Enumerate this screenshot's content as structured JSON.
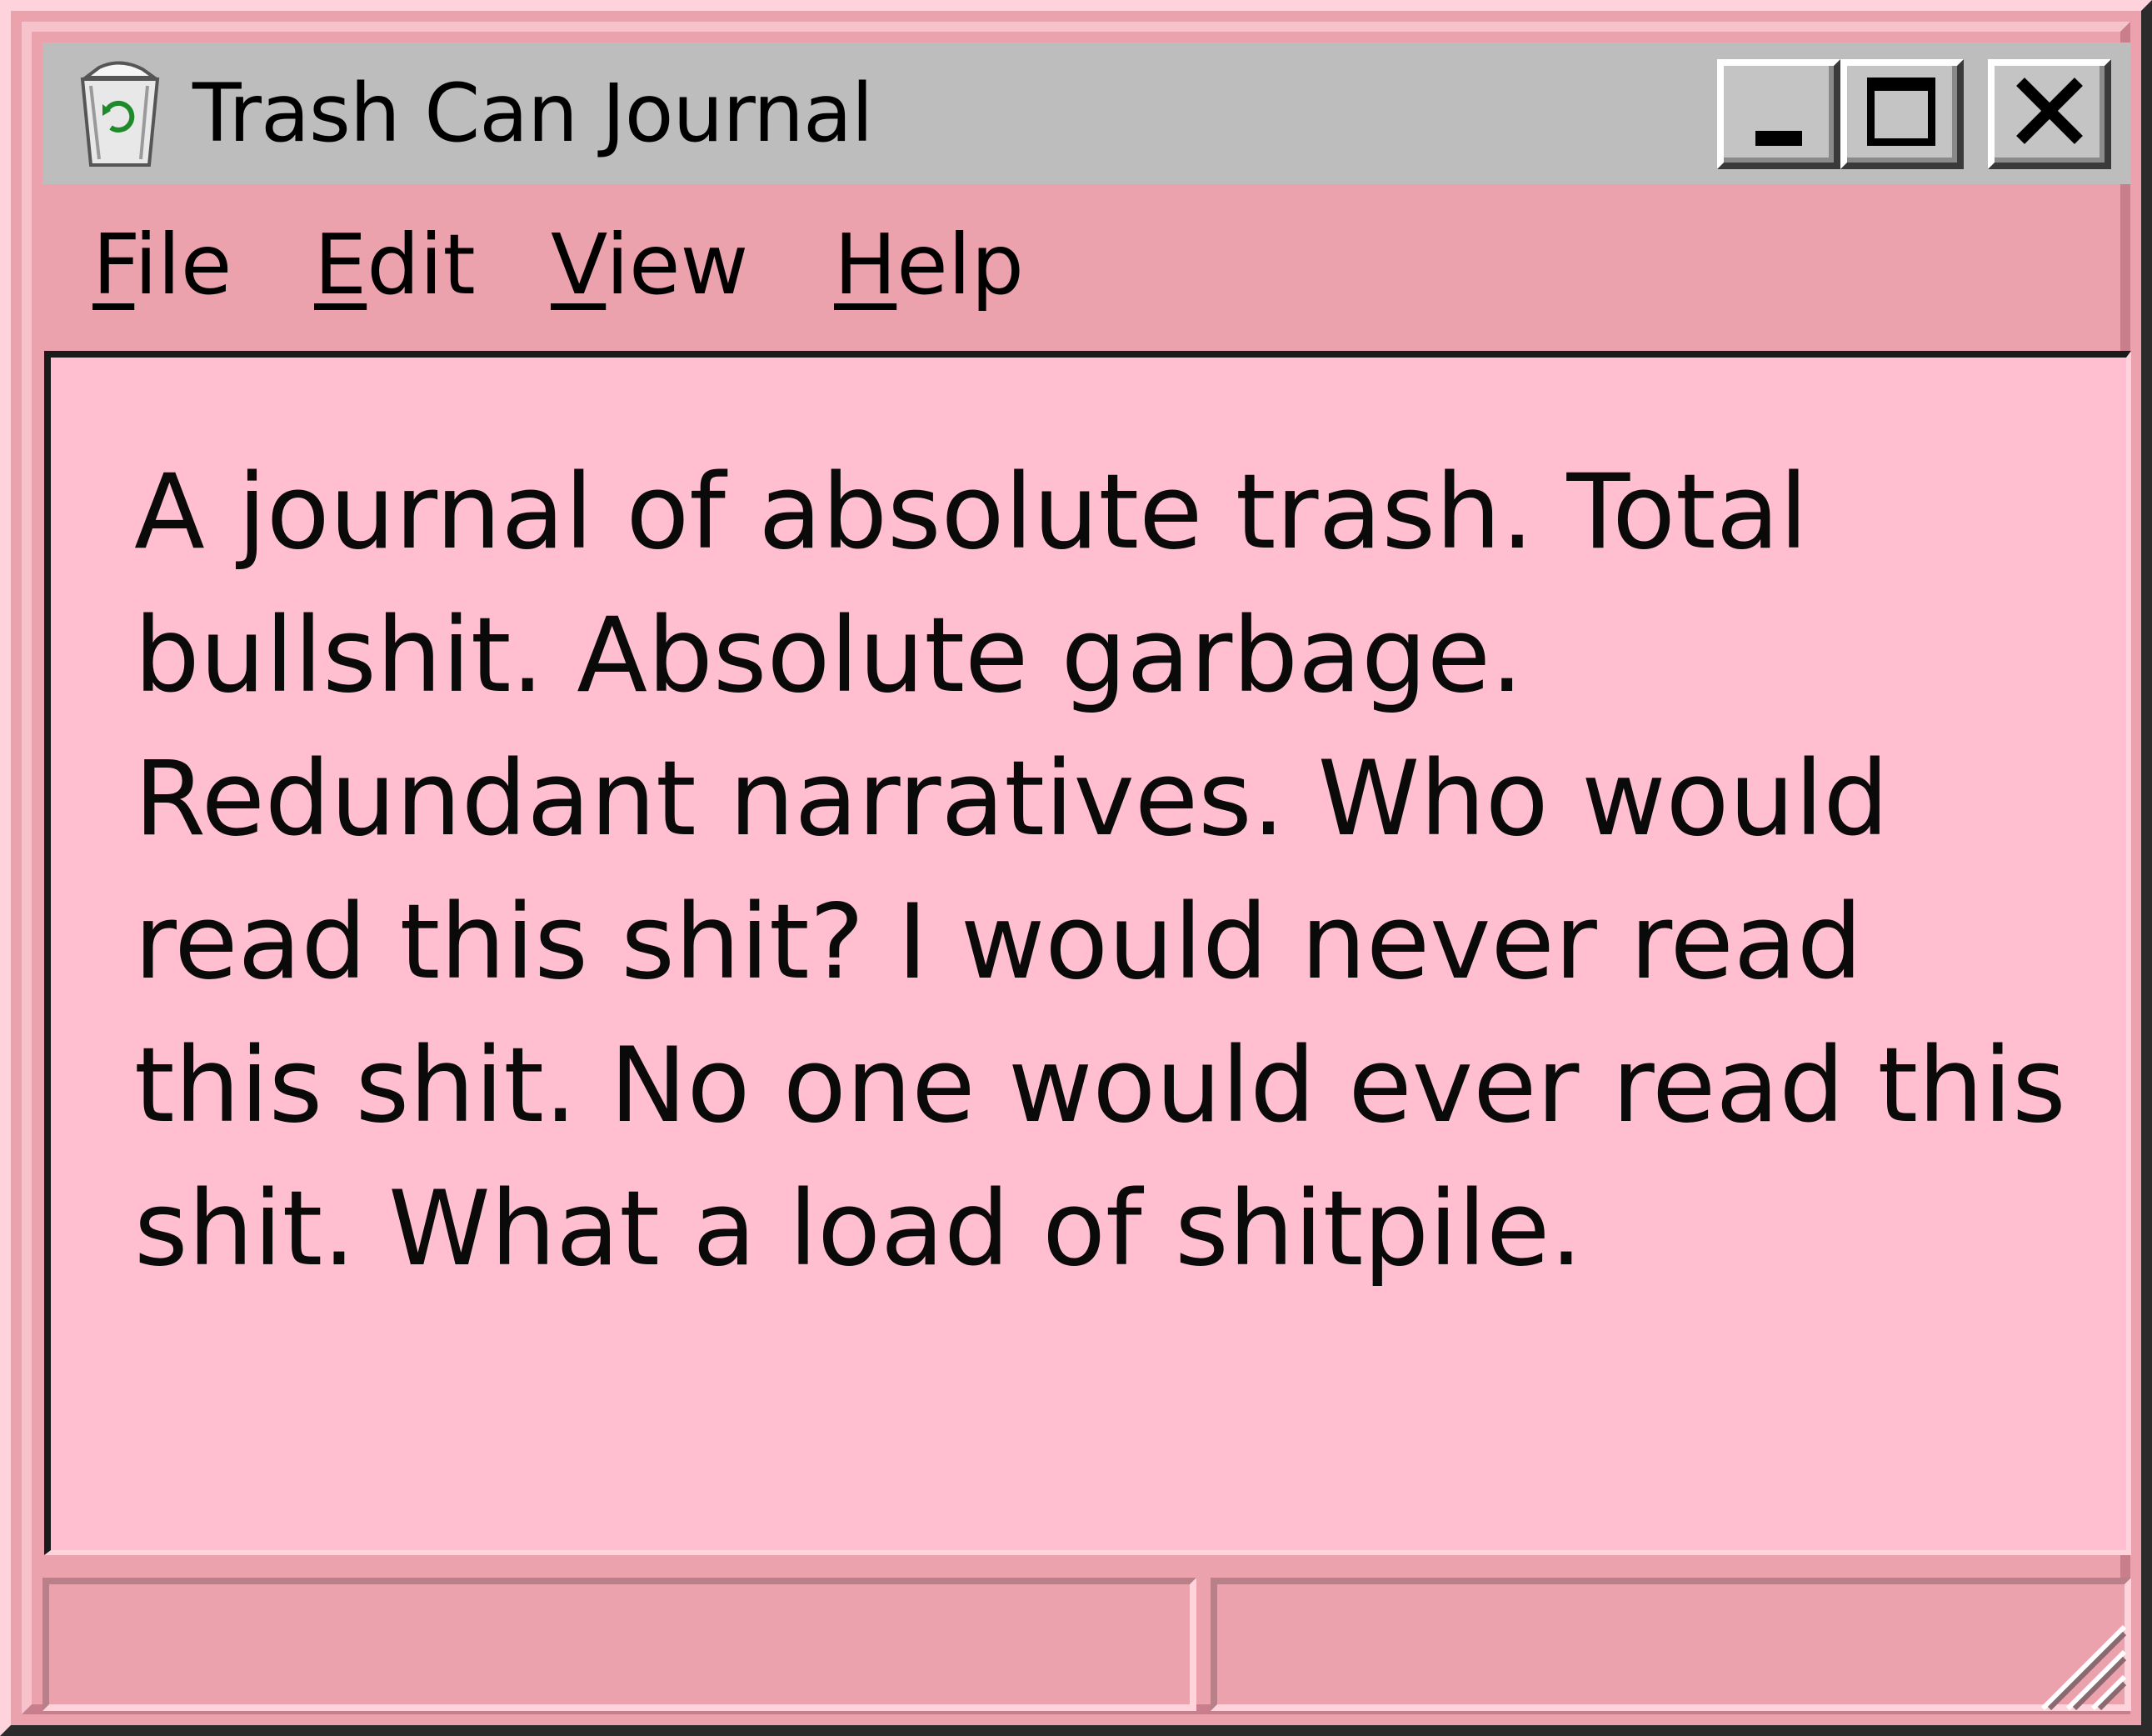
{
  "window": {
    "title": "Trash Can Journal",
    "title_icon": "recycle-bin-icon"
  },
  "controls": {
    "minimize_icon": "minimize-icon",
    "maximize_icon": "maximize-icon",
    "close_icon": "close-icon"
  },
  "menu": {
    "items": [
      {
        "accel": "F",
        "rest": "ile"
      },
      {
        "accel": "E",
        "rest": "dit"
      },
      {
        "accel": "V",
        "rest": "iew"
      },
      {
        "accel": "H",
        "rest": "elp"
      }
    ]
  },
  "document": {
    "body": "A journal of absolute trash. Total bullshit. Absolute garbage. Redundant narratives. Who would read this shit? I would never read this shit. No one would ever read this shit. What a load of shitpile."
  },
  "statusbar": {
    "pane1": "",
    "pane2": ""
  },
  "colors": {
    "frame": "#eca2ad",
    "titlebar": "#bdbdbd",
    "text_background": "#ffbfd0",
    "text": "#0a0a0a"
  }
}
